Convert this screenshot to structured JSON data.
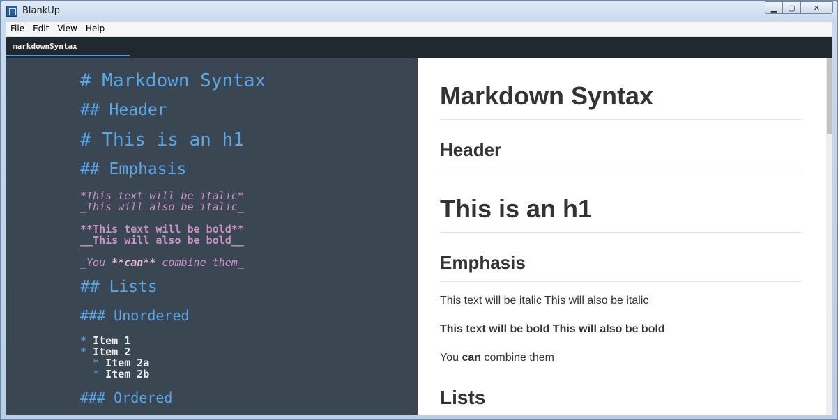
{
  "window": {
    "title": "BlankUp",
    "min_label": "▁",
    "max_label": "▢",
    "close_label": "✕"
  },
  "menu": {
    "items": [
      "File",
      "Edit",
      "View",
      "Help"
    ]
  },
  "tabs": [
    {
      "label": "markdownSyntax",
      "active": true
    }
  ],
  "editor": {
    "lines": {
      "h1": "# Markdown Syntax",
      "header": "## Header",
      "this_h1": "# This is an h1",
      "emphasis": "## Emphasis",
      "ital1": "*This text will be italic*",
      "ital2": "_This will also be italic_",
      "bold1": "**This text will be bold**",
      "bold2": "__This will also be bold__",
      "combine_a": "_You ",
      "combine_b": "**can**",
      "combine_c": " combine them_",
      "lists": "## Lists",
      "unordered": "### Unordered",
      "item1_bullet": "* ",
      "item1": "Item 1",
      "item2_bullet": "* ",
      "item2": "Item 2",
      "item2a_bullet": "  * ",
      "item2a": "Item 2a",
      "item2b_bullet": "  * ",
      "item2b": "Item 2b",
      "ordered": "### Ordered"
    }
  },
  "preview": {
    "title": "Markdown Syntax",
    "header": "Header",
    "h1": "This is an h1",
    "emphasis": "Emphasis",
    "italic_line": "This text will be italic This will also be italic",
    "bold_line": "This text will be bold This will also be bold",
    "combine_pre": "You ",
    "combine_bold": "can",
    "combine_post": " combine them",
    "lists": "Lists"
  },
  "colors": {
    "editor_bg": "#3b4653",
    "heading_md": "#5aa7e8",
    "emphasis_md": "#c895c8",
    "tab_accent": "#4c9ee6"
  }
}
